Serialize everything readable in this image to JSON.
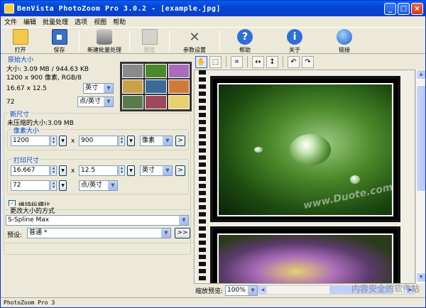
{
  "window": {
    "title": "BenVista PhotoZoom Pro 3.0.2 - [example.jpg]"
  },
  "menu": [
    "文件",
    "编辑",
    "批量处理",
    "选项",
    "视图",
    "帮助"
  ],
  "toolbar": {
    "open": "打开",
    "save": "保存",
    "batch": "新建批量处理",
    "preview": "预览",
    "settings": "参数设置",
    "help": "帮助",
    "about": "关于",
    "link": "链接"
  },
  "original": {
    "title": "原始大小",
    "size": "大小: 3.09 MB / 944.63 KB",
    "dims": "1200 x 900 像素, RGB/8",
    "physical": "16.67 x 12.5",
    "physical_unit": "英寸",
    "resolution": "72",
    "resolution_unit": "点/英寸"
  },
  "newsize": {
    "title": "新尺寸",
    "uncompressed": "未压缩的大小:3.09 MB",
    "pixel_title": "像素大小",
    "width": "1200",
    "height": "900",
    "pixel_unit": "像素",
    "print_title": "打印尺寸",
    "print_width": "16.667",
    "print_height": "12.5",
    "print_unit": "英寸",
    "print_res": "72",
    "print_res_unit": "点/英寸",
    "keep_ratio": "维持纵横比",
    "times": "x",
    "go": ">"
  },
  "method": {
    "title": "更改大小的方式",
    "value": "S-Spline Max",
    "preset_label": "预设:",
    "preset_value": "普通 *",
    "more": ">>"
  },
  "preview": {
    "watermark": "www.Duote.com"
  },
  "zoom": {
    "label": "缩放预览:",
    "value": "100%"
  },
  "statusbar": {
    "text": "PhotoZoom Pro 3"
  },
  "watermark_site": "内容安全的软件站"
}
